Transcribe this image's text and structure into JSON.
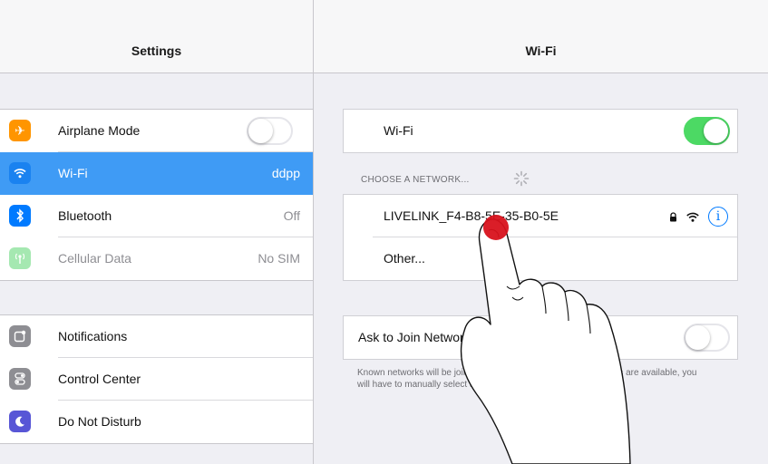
{
  "left": {
    "title": "Settings",
    "group1": [
      {
        "label": "Airplane Mode",
        "icon": "airplane-icon",
        "color": "#ff9500",
        "toggle": false
      },
      {
        "label": "Wi-Fi",
        "value": "ddpp",
        "icon": "wifi-icon",
        "color": "#007aff",
        "selected": true
      },
      {
        "label": "Bluetooth",
        "value": "Off",
        "icon": "bluetooth-icon",
        "color": "#007aff"
      },
      {
        "label": "Cellular Data",
        "value": "No SIM",
        "icon": "antenna-icon",
        "color": "#4cd964",
        "dim": true
      }
    ],
    "group2": [
      {
        "label": "Notifications",
        "icon": "notifications-icon",
        "color": "#8e8e93"
      },
      {
        "label": "Control Center",
        "icon": "control-center-icon",
        "color": "#8e8e93"
      },
      {
        "label": "Do Not Disturb",
        "icon": "moon-icon",
        "color": "#5856d6"
      }
    ]
  },
  "right": {
    "title": "Wi-Fi",
    "wifi_label": "Wi-Fi",
    "wifi_on": true,
    "choose_header": "CHOOSE A NETWORK...",
    "networks": [
      {
        "name": "LIVELINK_F4-B8-5E-35-B0-5E",
        "locked": true
      }
    ],
    "other_label": "Other...",
    "ask_label": "Ask to Join Networks",
    "ask_on": false,
    "footnote": "Known networks will be joined automatically. If no known networks are available, you will have to manually select a network."
  }
}
